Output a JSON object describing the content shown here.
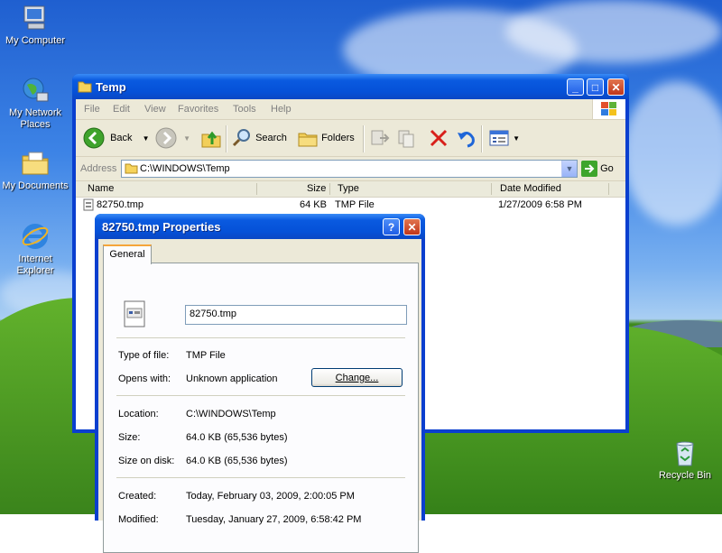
{
  "desktop": {
    "icons": [
      {
        "label": "My Computer",
        "icon": "my-computer-icon"
      },
      {
        "label": "My Network Places",
        "icon": "network-places-icon"
      },
      {
        "label": "My Documents",
        "icon": "my-documents-icon"
      },
      {
        "label": "Internet Explorer",
        "icon": "internet-explorer-icon"
      },
      {
        "label": "Recycle Bin",
        "icon": "recycle-bin-icon"
      }
    ]
  },
  "explorer": {
    "title": "Temp",
    "menu": [
      "File",
      "Edit",
      "View",
      "Favorites",
      "Tools",
      "Help"
    ],
    "toolbar": {
      "back_label": "Back",
      "search_label": "Search",
      "folders_label": "Folders"
    },
    "address": {
      "label": "Address",
      "value": "C:\\WINDOWS\\Temp",
      "go_label": "Go"
    },
    "columns": [
      "Name",
      "Size",
      "Type",
      "Date Modified"
    ],
    "files": [
      {
        "name": "82750.tmp",
        "size": "64 KB",
        "type": "TMP File",
        "modified": "1/27/2009 6:58 PM"
      }
    ]
  },
  "properties": {
    "title": "82750.tmp Properties",
    "tab": "General",
    "file_name": "82750.tmp",
    "type_label": "Type of file:",
    "type_value": "TMP File",
    "opens_label": "Opens with:",
    "opens_value": "Unknown application",
    "change_button": "Change...",
    "location_label": "Location:",
    "location_value": "C:\\WINDOWS\\Temp",
    "size_label": "Size:",
    "size_value": "64.0 KB (65,536 bytes)",
    "size_disk_label": "Size on disk:",
    "size_disk_value": "64.0 KB (65,536 bytes)",
    "created_label": "Created:",
    "created_value": "Today, February 03, 2009, 2:00:05 PM",
    "modified_label": "Modified:",
    "modified_value": "Tuesday, January 27, 2009, 6:58:42 PM"
  },
  "colors": {
    "titlebar_blue": "#0551d8",
    "window_face": "#ece9d8",
    "delete_red": "#d8201a"
  }
}
